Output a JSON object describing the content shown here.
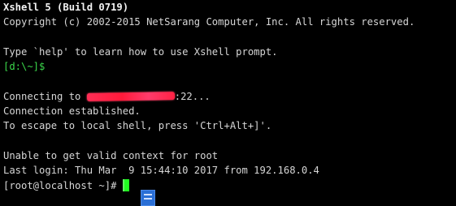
{
  "terminal": {
    "title_line": "Xshell 5 (Build 0719)",
    "copyright_line": "Copyright (c) 2002-2015 NetSarang Computer, Inc. All rights reserved.",
    "help_line": "Type `help' to learn how to use Xshell prompt.",
    "local_prompt": "[d:\\~]$",
    "connecting_prefix": "Connecting to ",
    "connecting_suffix": ":22...",
    "connection_established": "Connection established.",
    "escape_hint": "To escape to local shell, press 'Ctrl+Alt+]'.",
    "context_warning": "Unable to get valid context for root",
    "last_login": "Last login: Thu Mar  9 15:44:10 2017 from 192.168.0.4",
    "remote_prompt": "[root@localhost ~]# "
  },
  "colors": {
    "background": "#000000",
    "text": "#d6d6d6",
    "prompt_green": "#3bd84b",
    "cursor": "#22ff22",
    "redaction": "#ff2d55"
  },
  "icons": {
    "taskbar_document": "document-icon"
  }
}
